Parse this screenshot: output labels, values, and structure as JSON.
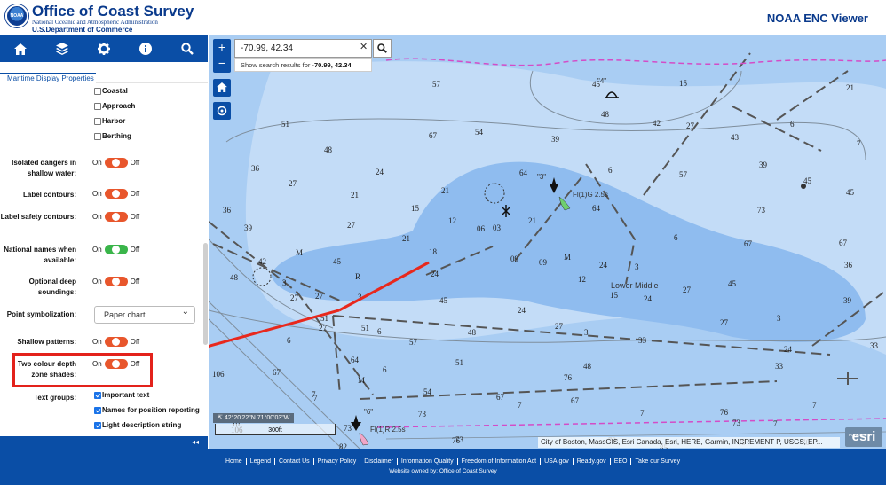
{
  "header": {
    "logo_text": "NOAA",
    "title": "Office of Coast Survey",
    "subtitle": "National Oceanic and Atmospheric Administration",
    "department": "U.S.Department of Commerce",
    "app_title": "NOAA ENC Viewer"
  },
  "toolbar": {
    "buttons": [
      "home-icon",
      "layers-icon",
      "gear-icon",
      "info-icon",
      "search-icon"
    ]
  },
  "panel": {
    "tab_label": "Maritime Display Properties",
    "checkboxes": [
      {
        "label": "Coastal",
        "checked": false
      },
      {
        "label": "Approach",
        "checked": false
      },
      {
        "label": "Harbor",
        "checked": false
      },
      {
        "label": "Berthing",
        "checked": false
      }
    ],
    "options": [
      {
        "label": "Isolated dangers in shallow water:",
        "on": "On",
        "off": "Off",
        "color": "#e8562c"
      },
      {
        "label": "Label contours:",
        "on": "On",
        "off": "Off",
        "color": "#e8562c"
      },
      {
        "label": "Label safety contours:",
        "on": "On",
        "off": "Off",
        "color": "#e8562c"
      },
      {
        "label": "National names when available:",
        "on": "On",
        "off": "Off",
        "color": "#3ab54a"
      },
      {
        "label": "Optional deep soundings:",
        "on": "On",
        "off": "Off",
        "color": "#e8562c"
      },
      {
        "label": "Point symbolization:",
        "select": "Paper chart"
      },
      {
        "label": "Shallow patterns:",
        "on": "On",
        "off": "Off",
        "color": "#e8562c"
      },
      {
        "label": "Two colour depth zone shades:",
        "on": "On",
        "off": "Off",
        "color": "#e8562c"
      }
    ],
    "text_groups_label": "Text groups:",
    "text_groups": [
      {
        "label": "Important text",
        "checked": true
      },
      {
        "label": "Names for position reporting",
        "checked": true
      },
      {
        "label": "Light description string",
        "checked": true
      }
    ],
    "collapse_label": "◂◂"
  },
  "map": {
    "search_value": "-70.99, 42.34",
    "suggestion_prefix": "Show search results for ",
    "suggestion_value": "-70.99, 42.34",
    "coords": "42°20'22\"N 71°00'03\"W",
    "scale_label": "300ft",
    "attribution": "City of Boston, MassGIS, Esri Canada, Esri, HERE, Garmin, INCREMENT P, USGS, EP...",
    "esri_label": "esri",
    "esri_powered": "POWERED BY",
    "area_label": "Lower Middle",
    "light_label_1": "Fl(1)G 2.5s",
    "light_label_2": "Fl(1)R 2.5s",
    "buoy_1": "\"3\"",
    "buoy_2": "\"4\"",
    "buoy_3": "\"6\"",
    "soundings": [
      {
        "t": "57"
      },
      {
        "t": "45"
      },
      {
        "t": "15"
      },
      {
        "t": "21"
      },
      {
        "t": "51"
      },
      {
        "t": "54"
      },
      {
        "t": "67"
      },
      {
        "t": "48"
      },
      {
        "t": "42"
      },
      {
        "t": "27"
      },
      {
        "t": "43"
      },
      {
        "t": "6"
      },
      {
        "t": "7"
      },
      {
        "t": "48"
      },
      {
        "t": "39"
      },
      {
        "t": "39"
      },
      {
        "t": "36"
      },
      {
        "t": "24"
      },
      {
        "t": "64"
      },
      {
        "t": "6"
      },
      {
        "t": "57"
      },
      {
        "t": "45"
      },
      {
        "t": "27"
      },
      {
        "t": "21"
      },
      {
        "t": "21"
      },
      {
        "t": "15"
      },
      {
        "t": "12"
      },
      {
        "t": "06"
      },
      {
        "t": "03"
      },
      {
        "t": "21"
      },
      {
        "t": "64"
      },
      {
        "t": "73"
      },
      {
        "t": "45"
      },
      {
        "t": "36"
      },
      {
        "t": "39"
      },
      {
        "t": "27"
      },
      {
        "t": "21"
      },
      {
        "t": "18"
      },
      {
        "t": "09"
      },
      {
        "t": "09"
      },
      {
        "t": "6"
      },
      {
        "t": "67"
      },
      {
        "t": "67"
      },
      {
        "t": "42"
      },
      {
        "t": "M"
      },
      {
        "t": "48"
      },
      {
        "t": "3"
      },
      {
        "t": "R"
      },
      {
        "t": "24"
      },
      {
        "t": "12"
      },
      {
        "t": "24"
      },
      {
        "t": "3"
      },
      {
        "t": "27"
      },
      {
        "t": "3"
      },
      {
        "t": "45"
      },
      {
        "t": "27"
      },
      {
        "t": "36"
      },
      {
        "t": "45"
      },
      {
        "t": "M"
      },
      {
        "t": "15"
      },
      {
        "t": "24"
      },
      {
        "t": "27"
      },
      {
        "t": "27"
      },
      {
        "t": "27"
      },
      {
        "t": "3"
      },
      {
        "t": "45"
      },
      {
        "t": "39"
      },
      {
        "t": "51"
      },
      {
        "t": "51"
      },
      {
        "t": "24"
      },
      {
        "t": "27"
      },
      {
        "t": "3"
      },
      {
        "t": "48"
      },
      {
        "t": "33"
      },
      {
        "t": "24"
      },
      {
        "t": "33"
      },
      {
        "t": "6"
      },
      {
        "t": "57"
      },
      {
        "t": "6"
      },
      {
        "t": "67"
      },
      {
        "t": "64"
      },
      {
        "t": "7"
      },
      {
        "t": "51"
      },
      {
        "t": "48"
      },
      {
        "t": "33"
      },
      {
        "t": "106"
      },
      {
        "t": "M"
      },
      {
        "t": "76"
      },
      {
        "t": "7"
      },
      {
        "t": "6"
      },
      {
        "t": "54"
      },
      {
        "t": "67"
      },
      {
        "t": "67"
      },
      {
        "t": "7"
      },
      {
        "t": "76"
      },
      {
        "t": "7"
      },
      {
        "t": "73"
      },
      {
        "t": "73"
      },
      {
        "t": "76"
      },
      {
        "t": "7"
      },
      {
        "t": "73"
      },
      {
        "t": "7"
      },
      {
        "t": "106"
      },
      {
        "t": "10"
      },
      {
        "t": "73"
      },
      {
        "t": "82"
      },
      {
        "t": "79"
      },
      {
        "t": "85"
      },
      {
        "t": "79"
      },
      {
        "t": "76"
      },
      {
        "t": "10"
      },
      {
        "t": "10"
      }
    ]
  },
  "footer": {
    "links": [
      "Home",
      "Legend",
      "Contact Us",
      "Privacy Policy",
      "Disclaimer",
      "Information Quality",
      "Freedom of Information Act",
      "USA.gov",
      "Ready.gov",
      "EEO",
      "Take our Survey"
    ],
    "owner": "Website owned by: Office of Coast Survey"
  }
}
